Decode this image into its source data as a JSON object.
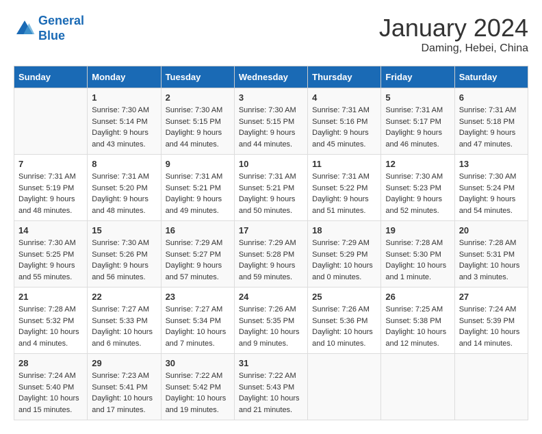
{
  "header": {
    "logo_line1": "General",
    "logo_line2": "Blue",
    "month": "January 2024",
    "location": "Daming, Hebei, China"
  },
  "weekdays": [
    "Sunday",
    "Monday",
    "Tuesday",
    "Wednesday",
    "Thursday",
    "Friday",
    "Saturday"
  ],
  "weeks": [
    [
      {
        "day": "",
        "info": ""
      },
      {
        "day": "1",
        "info": "Sunrise: 7:30 AM\nSunset: 5:14 PM\nDaylight: 9 hours\nand 43 minutes."
      },
      {
        "day": "2",
        "info": "Sunrise: 7:30 AM\nSunset: 5:15 PM\nDaylight: 9 hours\nand 44 minutes."
      },
      {
        "day": "3",
        "info": "Sunrise: 7:30 AM\nSunset: 5:15 PM\nDaylight: 9 hours\nand 44 minutes."
      },
      {
        "day": "4",
        "info": "Sunrise: 7:31 AM\nSunset: 5:16 PM\nDaylight: 9 hours\nand 45 minutes."
      },
      {
        "day": "5",
        "info": "Sunrise: 7:31 AM\nSunset: 5:17 PM\nDaylight: 9 hours\nand 46 minutes."
      },
      {
        "day": "6",
        "info": "Sunrise: 7:31 AM\nSunset: 5:18 PM\nDaylight: 9 hours\nand 47 minutes."
      }
    ],
    [
      {
        "day": "7",
        "info": "Sunrise: 7:31 AM\nSunset: 5:19 PM\nDaylight: 9 hours\nand 48 minutes."
      },
      {
        "day": "8",
        "info": "Sunrise: 7:31 AM\nSunset: 5:20 PM\nDaylight: 9 hours\nand 48 minutes."
      },
      {
        "day": "9",
        "info": "Sunrise: 7:31 AM\nSunset: 5:21 PM\nDaylight: 9 hours\nand 49 minutes."
      },
      {
        "day": "10",
        "info": "Sunrise: 7:31 AM\nSunset: 5:21 PM\nDaylight: 9 hours\nand 50 minutes."
      },
      {
        "day": "11",
        "info": "Sunrise: 7:31 AM\nSunset: 5:22 PM\nDaylight: 9 hours\nand 51 minutes."
      },
      {
        "day": "12",
        "info": "Sunrise: 7:30 AM\nSunset: 5:23 PM\nDaylight: 9 hours\nand 52 minutes."
      },
      {
        "day": "13",
        "info": "Sunrise: 7:30 AM\nSunset: 5:24 PM\nDaylight: 9 hours\nand 54 minutes."
      }
    ],
    [
      {
        "day": "14",
        "info": "Sunrise: 7:30 AM\nSunset: 5:25 PM\nDaylight: 9 hours\nand 55 minutes."
      },
      {
        "day": "15",
        "info": "Sunrise: 7:30 AM\nSunset: 5:26 PM\nDaylight: 9 hours\nand 56 minutes."
      },
      {
        "day": "16",
        "info": "Sunrise: 7:29 AM\nSunset: 5:27 PM\nDaylight: 9 hours\nand 57 minutes."
      },
      {
        "day": "17",
        "info": "Sunrise: 7:29 AM\nSunset: 5:28 PM\nDaylight: 9 hours\nand 59 minutes."
      },
      {
        "day": "18",
        "info": "Sunrise: 7:29 AM\nSunset: 5:29 PM\nDaylight: 10 hours\nand 0 minutes."
      },
      {
        "day": "19",
        "info": "Sunrise: 7:28 AM\nSunset: 5:30 PM\nDaylight: 10 hours\nand 1 minute."
      },
      {
        "day": "20",
        "info": "Sunrise: 7:28 AM\nSunset: 5:31 PM\nDaylight: 10 hours\nand 3 minutes."
      }
    ],
    [
      {
        "day": "21",
        "info": "Sunrise: 7:28 AM\nSunset: 5:32 PM\nDaylight: 10 hours\nand 4 minutes."
      },
      {
        "day": "22",
        "info": "Sunrise: 7:27 AM\nSunset: 5:33 PM\nDaylight: 10 hours\nand 6 minutes."
      },
      {
        "day": "23",
        "info": "Sunrise: 7:27 AM\nSunset: 5:34 PM\nDaylight: 10 hours\nand 7 minutes."
      },
      {
        "day": "24",
        "info": "Sunrise: 7:26 AM\nSunset: 5:35 PM\nDaylight: 10 hours\nand 9 minutes."
      },
      {
        "day": "25",
        "info": "Sunrise: 7:26 AM\nSunset: 5:36 PM\nDaylight: 10 hours\nand 10 minutes."
      },
      {
        "day": "26",
        "info": "Sunrise: 7:25 AM\nSunset: 5:38 PM\nDaylight: 10 hours\nand 12 minutes."
      },
      {
        "day": "27",
        "info": "Sunrise: 7:24 AM\nSunset: 5:39 PM\nDaylight: 10 hours\nand 14 minutes."
      }
    ],
    [
      {
        "day": "28",
        "info": "Sunrise: 7:24 AM\nSunset: 5:40 PM\nDaylight: 10 hours\nand 15 minutes."
      },
      {
        "day": "29",
        "info": "Sunrise: 7:23 AM\nSunset: 5:41 PM\nDaylight: 10 hours\nand 17 minutes."
      },
      {
        "day": "30",
        "info": "Sunrise: 7:22 AM\nSunset: 5:42 PM\nDaylight: 10 hours\nand 19 minutes."
      },
      {
        "day": "31",
        "info": "Sunrise: 7:22 AM\nSunset: 5:43 PM\nDaylight: 10 hours\nand 21 minutes."
      },
      {
        "day": "",
        "info": ""
      },
      {
        "day": "",
        "info": ""
      },
      {
        "day": "",
        "info": ""
      }
    ]
  ]
}
